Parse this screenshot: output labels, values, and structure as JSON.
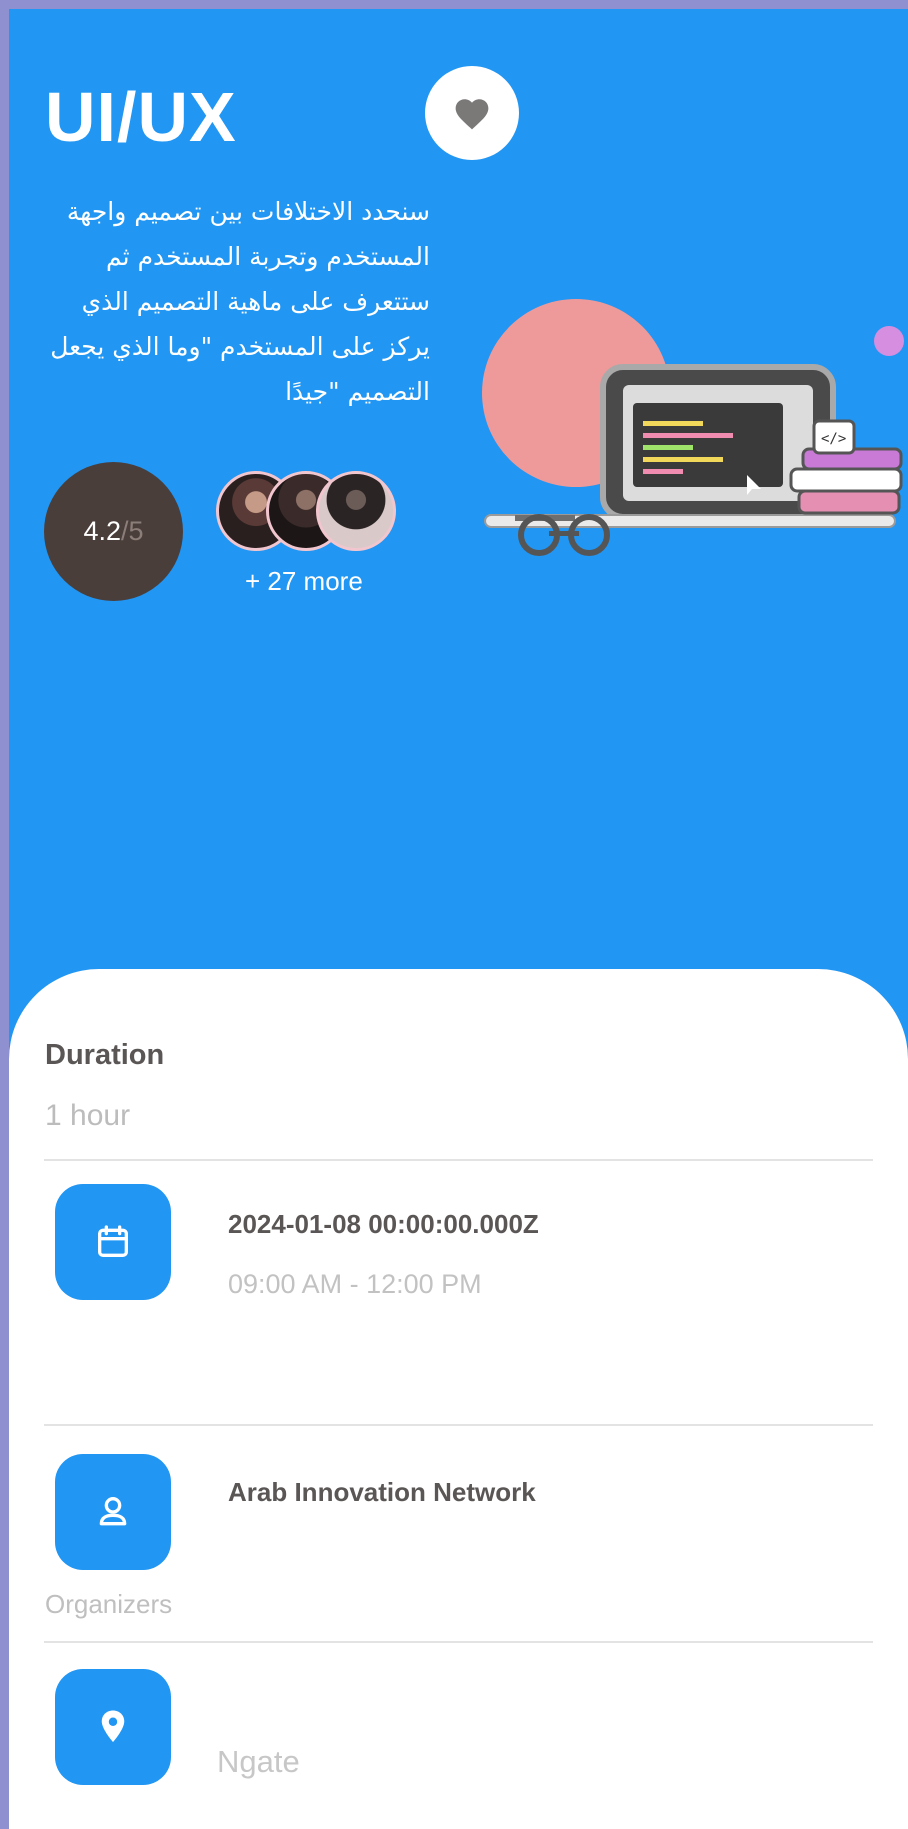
{
  "event": {
    "title": "UI/UX",
    "description": "سنحدد الاختلافات بين تصميم واجهة المستخدم وتجربة المستخدم ثم ستتعرف على ماهية التصميم الذي يركز على المستخدم \"وما الذي يجعل التصميم \"جيدًا",
    "rating_value": "4.2",
    "rating_max": "/5",
    "attendees_more": "+ 27 more"
  },
  "details": {
    "duration_label": "Duration",
    "duration_value": "1 hour",
    "date": "2024-01-08 00:00:00.000Z",
    "time": "09:00 AM - 12:00 PM",
    "organizer_name": "Arab Innovation Network",
    "organizers_label": "Organizers",
    "location": "Ngate"
  },
  "colors": {
    "primary": "#2196f3",
    "rating_bg": "#4a3e3b",
    "frame": "#8f90cf"
  },
  "icons": {
    "favorite": "heart-icon",
    "date": "calendar-icon",
    "organizer": "user-icon",
    "location": "map-pin-icon"
  }
}
